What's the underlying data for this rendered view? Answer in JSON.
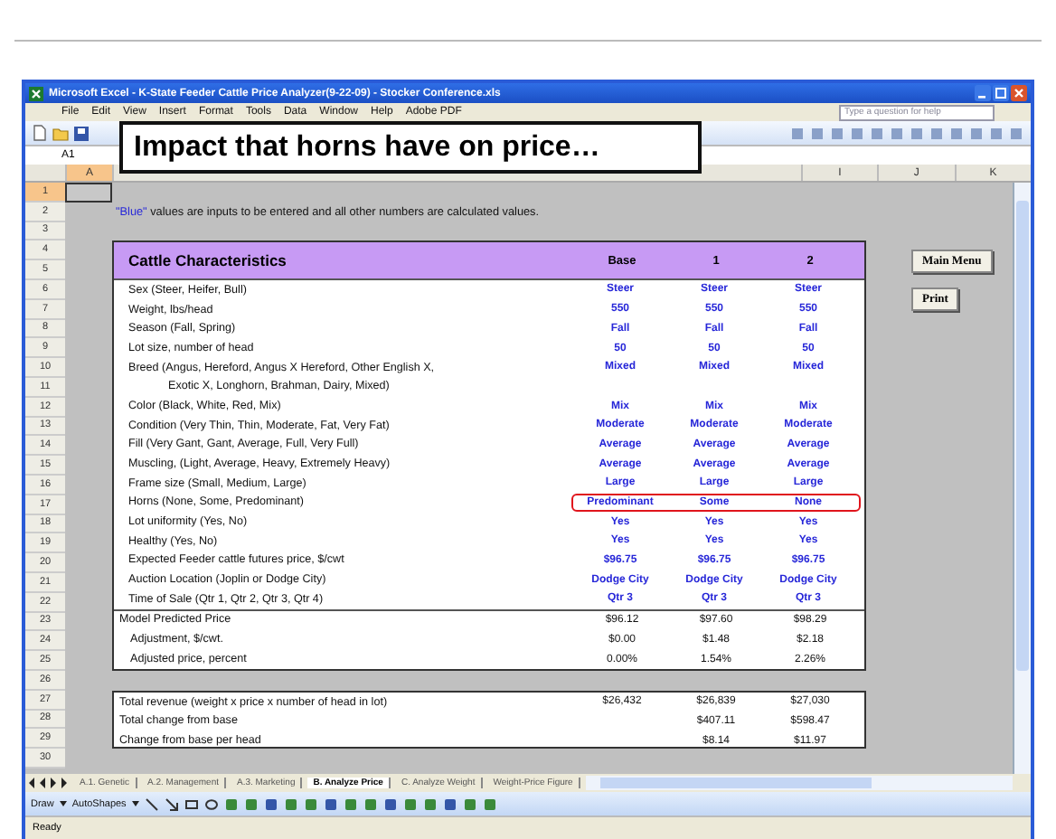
{
  "window": {
    "title": "Microsoft Excel - K-State Feeder Cattle Price Analyzer(9-22-09) - Stocker Conference.xls"
  },
  "menu": [
    "File",
    "Edit",
    "View",
    "Insert",
    "Format",
    "Tools",
    "Data",
    "Window",
    "Help",
    "Adobe PDF"
  ],
  "help_box": {
    "placeholder": "Type a question for help"
  },
  "name_box": "A1",
  "callout": "Impact that horns have on price…",
  "columns": [
    "A",
    "I",
    "J",
    "K"
  ],
  "row_numbers": [
    "1",
    "2",
    "3",
    "4",
    "5",
    "6",
    "7",
    "8",
    "9",
    "10",
    "11",
    "12",
    "13",
    "14",
    "15",
    "16",
    "17",
    "18",
    "19",
    "20",
    "21",
    "22",
    "23",
    "24",
    "25",
    "26",
    "27",
    "28",
    "29",
    "30"
  ],
  "note": {
    "highlight": "\"Blue\"",
    "text": "values are inputs to be entered and all other numbers are calculated values."
  },
  "table": {
    "title": "Cattle Characteristics",
    "columns": [
      "Base",
      "1",
      "2"
    ],
    "inputs": [
      {
        "label": "Sex (Steer, Heifer, Bull)",
        "kind": "input",
        "values": [
          "Steer",
          "Steer",
          "Steer"
        ],
        "highlighted": false
      },
      {
        "label": "Weight, lbs/head",
        "kind": "input",
        "values": [
          "550",
          "550",
          "550"
        ],
        "highlighted": false
      },
      {
        "label": "Season (Fall, Spring)",
        "kind": "input",
        "values": [
          "Fall",
          "Fall",
          "Fall"
        ],
        "highlighted": false
      },
      {
        "label": "Lot size, number of head",
        "kind": "input",
        "values": [
          "50",
          "50",
          "50"
        ],
        "highlighted": false
      },
      {
        "label": "Breed  (Angus, Hereford, Angus X Hereford, Other English X,",
        "kind": "input",
        "values": [
          "Mixed",
          "Mixed",
          "Mixed"
        ],
        "highlighted": false
      },
      {
        "label": "Exotic X, Longhorn, Brahman, Dairy, Mixed)",
        "kind": "continuation",
        "highlighted": false
      },
      {
        "label": "Color (Black, White, Red, Mix)",
        "kind": "input",
        "values": [
          "Mix",
          "Mix",
          "Mix"
        ],
        "highlighted": false
      },
      {
        "label": "Condition (Very Thin, Thin, Moderate, Fat, Very Fat)",
        "kind": "input",
        "values": [
          "Moderate",
          "Moderate",
          "Moderate"
        ],
        "highlighted": false
      },
      {
        "label": "Fill (Very Gant, Gant, Average, Full, Very Full)",
        "kind": "input",
        "values": [
          "Average",
          "Average",
          "Average"
        ],
        "highlighted": false
      },
      {
        "label": "Muscling, (Light, Average, Heavy, Extremely Heavy)",
        "kind": "input",
        "values": [
          "Average",
          "Average",
          "Average"
        ],
        "highlighted": false
      },
      {
        "label": "Frame size (Small, Medium, Large)",
        "kind": "input",
        "values": [
          "Large",
          "Large",
          "Large"
        ],
        "highlighted": false
      },
      {
        "label": "Horns (None, Some, Predominant)",
        "kind": "input",
        "values": [
          "Predominant",
          "Some",
          "None"
        ],
        "highlighted": true
      },
      {
        "label": "Lot uniformity (Yes, No)",
        "kind": "input",
        "values": [
          "Yes",
          "Yes",
          "Yes"
        ],
        "highlighted": false
      },
      {
        "label": "Healthy (Yes, No)",
        "kind": "input",
        "values": [
          "Yes",
          "Yes",
          "Yes"
        ],
        "highlighted": false
      },
      {
        "label": "Expected Feeder cattle futures price, $/cwt",
        "kind": "input",
        "values": [
          "$96.75",
          "$96.75",
          "$96.75"
        ],
        "highlighted": false
      },
      {
        "label": "Auction Location (Joplin or Dodge City)",
        "kind": "input",
        "values": [
          "Dodge City",
          "Dodge City",
          "Dodge City"
        ],
        "highlighted": false
      },
      {
        "label": "Time of Sale (Qtr 1, Qtr 2, Qtr 3, Qtr 4)",
        "kind": "input",
        "values": [
          "Qtr 3",
          "Qtr 3",
          "Qtr 3"
        ],
        "highlighted": false
      }
    ],
    "results": [
      {
        "label": "Model Predicted Price",
        "indented": false,
        "values": [
          "$96.12",
          "$97.60",
          "$98.29"
        ]
      },
      {
        "label": "Adjustment, $/cwt.",
        "indented": true,
        "values": [
          "$0.00",
          "$1.48",
          "$2.18"
        ]
      },
      {
        "label": "Adjusted price, percent",
        "indented": true,
        "values": [
          "0.00%",
          "1.54%",
          "2.26%"
        ]
      }
    ]
  },
  "revenue": [
    {
      "label": "Total revenue (weight x price x number of head in lot)",
      "values": [
        "$26,432",
        "$26,839",
        "$27,030"
      ]
    },
    {
      "label": "Total change from base",
      "values": [
        "$407.11",
        "$598.47"
      ]
    },
    {
      "label": "Change from base per head",
      "values": [
        "$8.14",
        "$11.97"
      ]
    }
  ],
  "buttons": [
    "Main Menu",
    "Print"
  ],
  "sheet_tabs": [
    {
      "label": "A.1. Genetic",
      "selected": false
    },
    {
      "label": "A.2. Management",
      "selected": false
    },
    {
      "label": "A.3. Marketing",
      "selected": false
    },
    {
      "label": "B. Analyze Price",
      "selected": true
    },
    {
      "label": "C. Analyze Weight",
      "selected": false
    },
    {
      "label": "Weight-Price Figure",
      "selected": false
    }
  ],
  "drawing_toolbar": [
    "Draw",
    "AutoShapes"
  ],
  "status": "Ready"
}
